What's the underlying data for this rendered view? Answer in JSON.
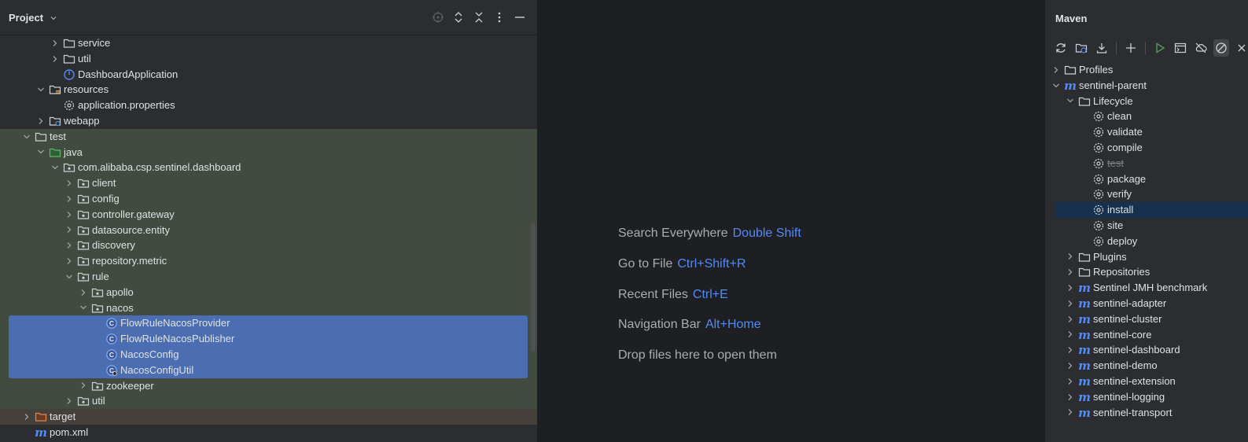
{
  "project_panel": {
    "title": "Project",
    "tools": [
      "locate-icon",
      "expand-icon",
      "collapse-icon",
      "more-icon",
      "hide-icon"
    ],
    "tree": [
      {
        "label": "service",
        "type": "folder",
        "depth": 3,
        "expanded": false
      },
      {
        "label": "util",
        "type": "folder",
        "depth": 3,
        "expanded": false
      },
      {
        "label": "DashboardApplication",
        "type": "spring-class",
        "depth": 3
      },
      {
        "label": "resources",
        "type": "resources-folder",
        "depth": 2,
        "expanded": true
      },
      {
        "label": "application.properties",
        "type": "properties",
        "depth": 3
      },
      {
        "label": "webapp",
        "type": "web-folder",
        "depth": 2,
        "expanded": false
      },
      {
        "label": "test",
        "type": "folder",
        "depth": 1,
        "expanded": true,
        "section": "test"
      },
      {
        "label": "java",
        "type": "test-source-folder",
        "depth": 2,
        "expanded": true,
        "section": "test"
      },
      {
        "label": "com.alibaba.csp.sentinel.dashboard",
        "type": "package",
        "depth": 3,
        "expanded": true,
        "section": "test"
      },
      {
        "label": "client",
        "type": "package",
        "depth": 4,
        "expanded": false,
        "section": "test"
      },
      {
        "label": "config",
        "type": "package",
        "depth": 4,
        "expanded": false,
        "section": "test"
      },
      {
        "label": "controller.gateway",
        "type": "package",
        "depth": 4,
        "expanded": false,
        "section": "test"
      },
      {
        "label": "datasource.entity",
        "type": "package",
        "depth": 4,
        "expanded": false,
        "section": "test"
      },
      {
        "label": "discovery",
        "type": "package",
        "depth": 4,
        "expanded": false,
        "section": "test"
      },
      {
        "label": "repository.metric",
        "type": "package",
        "depth": 4,
        "expanded": false,
        "section": "test"
      },
      {
        "label": "rule",
        "type": "package",
        "depth": 4,
        "expanded": true,
        "section": "test"
      },
      {
        "label": "apollo",
        "type": "package",
        "depth": 5,
        "expanded": false,
        "section": "test"
      },
      {
        "label": "nacos",
        "type": "package",
        "depth": 5,
        "expanded": true,
        "section": "test"
      },
      {
        "label": "FlowRuleNacosProvider",
        "type": "class",
        "depth": 6,
        "section": "selected"
      },
      {
        "label": "FlowRuleNacosPublisher",
        "type": "class",
        "depth": 6,
        "section": "selected"
      },
      {
        "label": "NacosConfig",
        "type": "class",
        "depth": 6,
        "section": "selected"
      },
      {
        "label": "NacosConfigUtil",
        "type": "class-util",
        "depth": 6,
        "section": "selected"
      },
      {
        "label": "zookeeper",
        "type": "package",
        "depth": 5,
        "expanded": false,
        "section": "test"
      },
      {
        "label": "util",
        "type": "package",
        "depth": 4,
        "expanded": false,
        "section": "test"
      },
      {
        "label": "target",
        "type": "excluded-folder",
        "depth": 1,
        "expanded": false,
        "section": "target"
      },
      {
        "label": "pom.xml",
        "type": "maven-file",
        "depth": 1
      }
    ]
  },
  "editor": {
    "hints": [
      {
        "text": "Search Everywhere",
        "key": "Double Shift"
      },
      {
        "text": "Go to File",
        "key": "Ctrl+Shift+R"
      },
      {
        "text": "Recent Files",
        "key": "Ctrl+E"
      },
      {
        "text": "Navigation Bar",
        "key": "Alt+Home"
      },
      {
        "text": "Drop files here to open them",
        "key": ""
      }
    ]
  },
  "maven_panel": {
    "title": "Maven",
    "toolbar": [
      "reload-icon",
      "add-project-icon",
      "download-icon",
      "plus-icon",
      "run-icon",
      "execute-goal-icon",
      "offline-icon",
      "skip-tests-icon",
      "close-icon"
    ],
    "tree": [
      {
        "label": "Profiles",
        "type": "folder",
        "depth": 0,
        "expanded": false
      },
      {
        "label": "sentinel-parent",
        "type": "maven",
        "depth": 0,
        "expanded": true
      },
      {
        "label": "Lifecycle",
        "type": "folder",
        "depth": 1,
        "expanded": true
      },
      {
        "label": "clean",
        "type": "goal",
        "depth": 2
      },
      {
        "label": "validate",
        "type": "goal",
        "depth": 2
      },
      {
        "label": "compile",
        "type": "goal",
        "depth": 2
      },
      {
        "label": "test",
        "type": "goal",
        "depth": 2,
        "skipped": true
      },
      {
        "label": "package",
        "type": "goal",
        "depth": 2
      },
      {
        "label": "verify",
        "type": "goal",
        "depth": 2
      },
      {
        "label": "install",
        "type": "goal",
        "depth": 2,
        "selected": true
      },
      {
        "label": "site",
        "type": "goal",
        "depth": 2
      },
      {
        "label": "deploy",
        "type": "goal",
        "depth": 2
      },
      {
        "label": "Plugins",
        "type": "folder",
        "depth": 1,
        "expanded": false
      },
      {
        "label": "Repositories",
        "type": "folder",
        "depth": 1,
        "expanded": false
      },
      {
        "label": "Sentinel JMH benchmark",
        "type": "maven",
        "depth": 1,
        "expanded": false
      },
      {
        "label": "sentinel-adapter",
        "type": "maven",
        "depth": 1,
        "expanded": false
      },
      {
        "label": "sentinel-cluster",
        "type": "maven",
        "depth": 1,
        "expanded": false
      },
      {
        "label": "sentinel-core",
        "type": "maven",
        "depth": 1,
        "expanded": false
      },
      {
        "label": "sentinel-dashboard",
        "type": "maven",
        "depth": 1,
        "expanded": false
      },
      {
        "label": "sentinel-demo",
        "type": "maven",
        "depth": 1,
        "expanded": false
      },
      {
        "label": "sentinel-extension",
        "type": "maven",
        "depth": 1,
        "expanded": false
      },
      {
        "label": "sentinel-logging",
        "type": "maven",
        "depth": 1,
        "expanded": false
      },
      {
        "label": "sentinel-transport",
        "type": "maven",
        "depth": 1,
        "expanded": false
      }
    ]
  },
  "colors": {
    "panel_bg": "#2b2d30",
    "editor_bg": "#1e1f22",
    "test_bg": "#414b3f",
    "selection": "#4a6eb1",
    "maven_selection": "#16304d",
    "accent": "#548af7",
    "target_bg": "#45403a"
  }
}
